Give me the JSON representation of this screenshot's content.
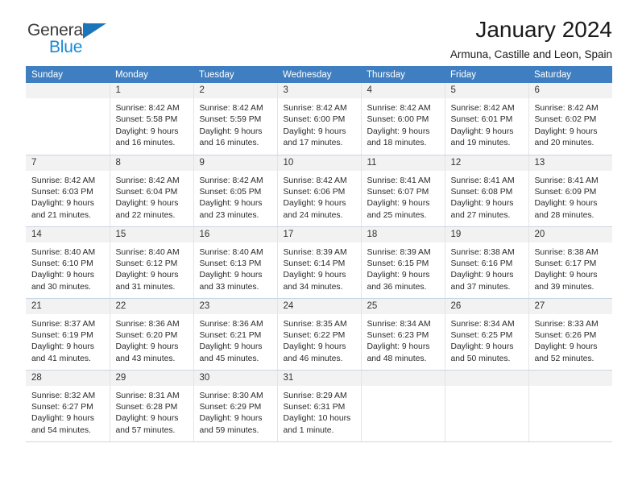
{
  "brand": {
    "name_dark": "General",
    "name_blue": "Blue",
    "accent_blue": "#1b75bb",
    "light_blue": "#1b8ad6"
  },
  "header": {
    "title": "January 2024",
    "subtitle": "Armuna, Castille and Leon, Spain"
  },
  "theme": {
    "header_row_bg": "#3f7fc1",
    "daynum_bg": "#f2f2f2",
    "cell_border": "#e4e4e4",
    "week_divider": "#c8d6e4"
  },
  "weekdays": [
    "Sunday",
    "Monday",
    "Tuesday",
    "Wednesday",
    "Thursday",
    "Friday",
    "Saturday"
  ],
  "weeks": [
    [
      {
        "day": "",
        "sunrise": "",
        "sunset": "",
        "daylight1": "",
        "daylight2": ""
      },
      {
        "day": "1",
        "sunrise": "Sunrise: 8:42 AM",
        "sunset": "Sunset: 5:58 PM",
        "daylight1": "Daylight: 9 hours",
        "daylight2": "and 16 minutes."
      },
      {
        "day": "2",
        "sunrise": "Sunrise: 8:42 AM",
        "sunset": "Sunset: 5:59 PM",
        "daylight1": "Daylight: 9 hours",
        "daylight2": "and 16 minutes."
      },
      {
        "day": "3",
        "sunrise": "Sunrise: 8:42 AM",
        "sunset": "Sunset: 6:00 PM",
        "daylight1": "Daylight: 9 hours",
        "daylight2": "and 17 minutes."
      },
      {
        "day": "4",
        "sunrise": "Sunrise: 8:42 AM",
        "sunset": "Sunset: 6:00 PM",
        "daylight1": "Daylight: 9 hours",
        "daylight2": "and 18 minutes."
      },
      {
        "day": "5",
        "sunrise": "Sunrise: 8:42 AM",
        "sunset": "Sunset: 6:01 PM",
        "daylight1": "Daylight: 9 hours",
        "daylight2": "and 19 minutes."
      },
      {
        "day": "6",
        "sunrise": "Sunrise: 8:42 AM",
        "sunset": "Sunset: 6:02 PM",
        "daylight1": "Daylight: 9 hours",
        "daylight2": "and 20 minutes."
      }
    ],
    [
      {
        "day": "7",
        "sunrise": "Sunrise: 8:42 AM",
        "sunset": "Sunset: 6:03 PM",
        "daylight1": "Daylight: 9 hours",
        "daylight2": "and 21 minutes."
      },
      {
        "day": "8",
        "sunrise": "Sunrise: 8:42 AM",
        "sunset": "Sunset: 6:04 PM",
        "daylight1": "Daylight: 9 hours",
        "daylight2": "and 22 minutes."
      },
      {
        "day": "9",
        "sunrise": "Sunrise: 8:42 AM",
        "sunset": "Sunset: 6:05 PM",
        "daylight1": "Daylight: 9 hours",
        "daylight2": "and 23 minutes."
      },
      {
        "day": "10",
        "sunrise": "Sunrise: 8:42 AM",
        "sunset": "Sunset: 6:06 PM",
        "daylight1": "Daylight: 9 hours",
        "daylight2": "and 24 minutes."
      },
      {
        "day": "11",
        "sunrise": "Sunrise: 8:41 AM",
        "sunset": "Sunset: 6:07 PM",
        "daylight1": "Daylight: 9 hours",
        "daylight2": "and 25 minutes."
      },
      {
        "day": "12",
        "sunrise": "Sunrise: 8:41 AM",
        "sunset": "Sunset: 6:08 PM",
        "daylight1": "Daylight: 9 hours",
        "daylight2": "and 27 minutes."
      },
      {
        "day": "13",
        "sunrise": "Sunrise: 8:41 AM",
        "sunset": "Sunset: 6:09 PM",
        "daylight1": "Daylight: 9 hours",
        "daylight2": "and 28 minutes."
      }
    ],
    [
      {
        "day": "14",
        "sunrise": "Sunrise: 8:40 AM",
        "sunset": "Sunset: 6:10 PM",
        "daylight1": "Daylight: 9 hours",
        "daylight2": "and 30 minutes."
      },
      {
        "day": "15",
        "sunrise": "Sunrise: 8:40 AM",
        "sunset": "Sunset: 6:12 PM",
        "daylight1": "Daylight: 9 hours",
        "daylight2": "and 31 minutes."
      },
      {
        "day": "16",
        "sunrise": "Sunrise: 8:40 AM",
        "sunset": "Sunset: 6:13 PM",
        "daylight1": "Daylight: 9 hours",
        "daylight2": "and 33 minutes."
      },
      {
        "day": "17",
        "sunrise": "Sunrise: 8:39 AM",
        "sunset": "Sunset: 6:14 PM",
        "daylight1": "Daylight: 9 hours",
        "daylight2": "and 34 minutes."
      },
      {
        "day": "18",
        "sunrise": "Sunrise: 8:39 AM",
        "sunset": "Sunset: 6:15 PM",
        "daylight1": "Daylight: 9 hours",
        "daylight2": "and 36 minutes."
      },
      {
        "day": "19",
        "sunrise": "Sunrise: 8:38 AM",
        "sunset": "Sunset: 6:16 PM",
        "daylight1": "Daylight: 9 hours",
        "daylight2": "and 37 minutes."
      },
      {
        "day": "20",
        "sunrise": "Sunrise: 8:38 AM",
        "sunset": "Sunset: 6:17 PM",
        "daylight1": "Daylight: 9 hours",
        "daylight2": "and 39 minutes."
      }
    ],
    [
      {
        "day": "21",
        "sunrise": "Sunrise: 8:37 AM",
        "sunset": "Sunset: 6:19 PM",
        "daylight1": "Daylight: 9 hours",
        "daylight2": "and 41 minutes."
      },
      {
        "day": "22",
        "sunrise": "Sunrise: 8:36 AM",
        "sunset": "Sunset: 6:20 PM",
        "daylight1": "Daylight: 9 hours",
        "daylight2": "and 43 minutes."
      },
      {
        "day": "23",
        "sunrise": "Sunrise: 8:36 AM",
        "sunset": "Sunset: 6:21 PM",
        "daylight1": "Daylight: 9 hours",
        "daylight2": "and 45 minutes."
      },
      {
        "day": "24",
        "sunrise": "Sunrise: 8:35 AM",
        "sunset": "Sunset: 6:22 PM",
        "daylight1": "Daylight: 9 hours",
        "daylight2": "and 46 minutes."
      },
      {
        "day": "25",
        "sunrise": "Sunrise: 8:34 AM",
        "sunset": "Sunset: 6:23 PM",
        "daylight1": "Daylight: 9 hours",
        "daylight2": "and 48 minutes."
      },
      {
        "day": "26",
        "sunrise": "Sunrise: 8:34 AM",
        "sunset": "Sunset: 6:25 PM",
        "daylight1": "Daylight: 9 hours",
        "daylight2": "and 50 minutes."
      },
      {
        "day": "27",
        "sunrise": "Sunrise: 8:33 AM",
        "sunset": "Sunset: 6:26 PM",
        "daylight1": "Daylight: 9 hours",
        "daylight2": "and 52 minutes."
      }
    ],
    [
      {
        "day": "28",
        "sunrise": "Sunrise: 8:32 AM",
        "sunset": "Sunset: 6:27 PM",
        "daylight1": "Daylight: 9 hours",
        "daylight2": "and 54 minutes."
      },
      {
        "day": "29",
        "sunrise": "Sunrise: 8:31 AM",
        "sunset": "Sunset: 6:28 PM",
        "daylight1": "Daylight: 9 hours",
        "daylight2": "and 57 minutes."
      },
      {
        "day": "30",
        "sunrise": "Sunrise: 8:30 AM",
        "sunset": "Sunset: 6:29 PM",
        "daylight1": "Daylight: 9 hours",
        "daylight2": "and 59 minutes."
      },
      {
        "day": "31",
        "sunrise": "Sunrise: 8:29 AM",
        "sunset": "Sunset: 6:31 PM",
        "daylight1": "Daylight: 10 hours",
        "daylight2": "and 1 minute."
      },
      {
        "day": "",
        "sunrise": "",
        "sunset": "",
        "daylight1": "",
        "daylight2": ""
      },
      {
        "day": "",
        "sunrise": "",
        "sunset": "",
        "daylight1": "",
        "daylight2": ""
      },
      {
        "day": "",
        "sunrise": "",
        "sunset": "",
        "daylight1": "",
        "daylight2": ""
      }
    ]
  ]
}
